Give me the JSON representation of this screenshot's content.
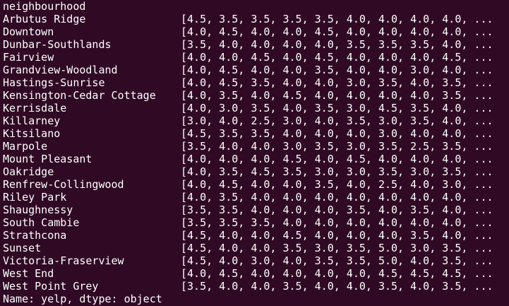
{
  "terminal": {
    "header": "neighbourhood",
    "rows": [
      {
        "name": "Arbutus Ridge",
        "values": "[4.5, 3.5, 3.5, 3.5, 3.5, 4.0, 4.0, 4.0, 4.0, ..."
      },
      {
        "name": "Downtown",
        "values": "[4.0, 4.5, 4.0, 4.0, 4.5, 4.0, 4.0, 4.0, 4.0, ..."
      },
      {
        "name": "Dunbar-Southlands",
        "values": "[3.5, 4.0, 4.0, 4.0, 4.0, 3.5, 3.5, 3.5, 4.0, ..."
      },
      {
        "name": "Fairview",
        "values": "[4.0, 4.0, 4.5, 4.0, 4.5, 4.0, 4.0, 4.0, 4.5, ..."
      },
      {
        "name": "Grandview-Woodland",
        "values": "[4.0, 4.5, 4.0, 4.0, 3.5, 4.0, 4.0, 3.0, 4.0, ..."
      },
      {
        "name": "Hastings-Sunrise",
        "values": "[4.0, 4.5, 3.5, 4.0, 4.0, 3.0, 3.5, 4.0, 3.5, ..."
      },
      {
        "name": "Kensington-Cedar Cottage",
        "values": "[4.0, 3.5, 4.0, 4.5, 4.0, 4.0, 4.0, 4.0, 3.5, ..."
      },
      {
        "name": "Kerrisdale",
        "values": "[4.0, 3.0, 3.5, 4.0, 3.5, 3.0, 4.5, 3.5, 4.0, ..."
      },
      {
        "name": "Killarney",
        "values": "[3.0, 4.0, 2.5, 3.0, 4.0, 3.5, 3.0, 3.5, 4.0, ..."
      },
      {
        "name": "Kitsilano",
        "values": "[4.5, 3.5, 3.5, 4.0, 4.0, 4.0, 3.0, 4.0, 4.0, ..."
      },
      {
        "name": "Marpole",
        "values": "[3.5, 4.0, 4.0, 3.0, 3.5, 3.0, 3.5, 2.5, 3.5, ..."
      },
      {
        "name": "Mount Pleasant",
        "values": "[4.0, 4.0, 4.0, 4.5, 4.0, 4.5, 4.0, 4.0, 4.0, ..."
      },
      {
        "name": "Oakridge",
        "values": "[4.0, 3.5, 4.5, 3.5, 3.0, 3.0, 3.5, 3.0, 3.5, ..."
      },
      {
        "name": "Renfrew-Collingwood",
        "values": "[4.0, 4.5, 4.0, 4.0, 3.5, 4.0, 2.5, 4.0, 3.0, ..."
      },
      {
        "name": "Riley Park",
        "values": "[4.0, 3.5, 4.0, 4.0, 4.0, 4.0, 4.0, 4.0, 4.0, ..."
      },
      {
        "name": "Shaughnessy",
        "values": "[3.5, 3.5, 4.0, 4.0, 4.0, 3.5, 4.0, 3.5, 4.0, ..."
      },
      {
        "name": "South Cambie",
        "values": "[3.5, 3.5, 3.5, 4.0, 4.0, 4.0, 4.0, 4.0, 4.0, ..."
      },
      {
        "name": "Strathcona",
        "values": "[4.5, 4.0, 4.0, 4.5, 4.0, 4.0, 4.0, 3.5, 4.0, ..."
      },
      {
        "name": "Sunset",
        "values": "[4.5, 4.0, 4.0, 3.5, 3.0, 3.5, 5.0, 3.0, 3.5, ..."
      },
      {
        "name": "Victoria-Fraserview",
        "values": "[4.5, 4.0, 3.0, 4.0, 3.5, 3.5, 5.0, 4.0, 3.5, ..."
      },
      {
        "name": "West End",
        "values": "[4.0, 4.5, 4.0, 4.0, 4.0, 4.0, 4.5, 4.5, 4.5, ..."
      },
      {
        "name": "West Point Grey",
        "values": "[3.5, 4.0, 4.0, 3.5, 4.0, 4.0, 3.5, 4.0, 3.5, ..."
      }
    ],
    "footer": "Name: yelp, dtype: object",
    "colors": {
      "background": "#300a24",
      "text": "#ffffff"
    }
  }
}
